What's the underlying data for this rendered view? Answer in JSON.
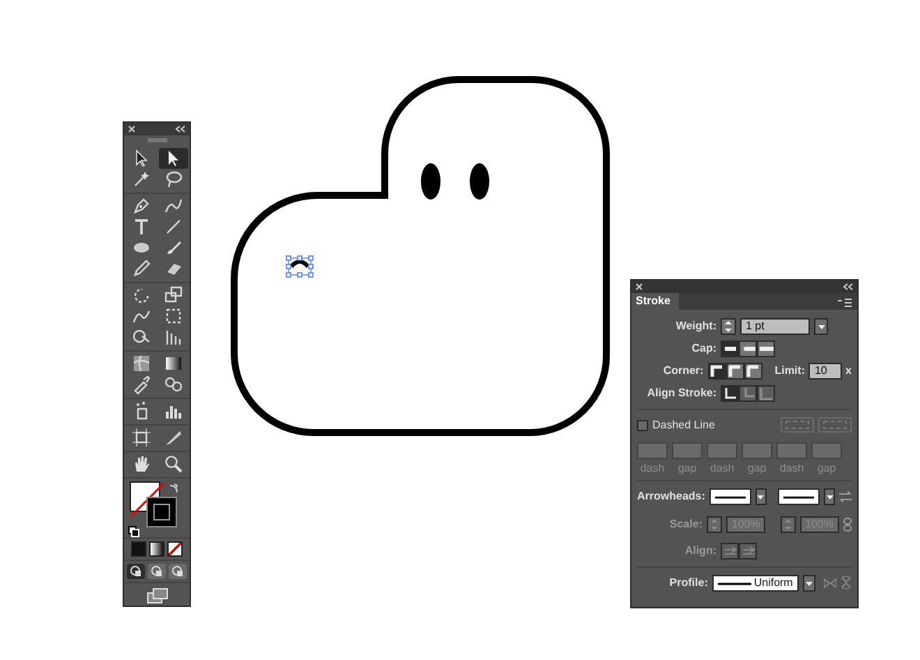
{
  "toolbar": {
    "tools": [
      {
        "kind": "selection",
        "selected": false
      },
      {
        "kind": "direct-selection",
        "selected": true
      },
      {
        "kind": "magic-wand",
        "selected": false
      },
      {
        "kind": "lasso",
        "selected": false
      },
      {
        "kind": "pen",
        "selected": false
      },
      {
        "kind": "curvature",
        "selected": false
      },
      {
        "kind": "type",
        "selected": false
      },
      {
        "kind": "line",
        "selected": false
      },
      {
        "kind": "ellipse",
        "selected": false
      },
      {
        "kind": "paintbrush",
        "selected": false
      },
      {
        "kind": "pencil",
        "selected": false
      },
      {
        "kind": "eraser",
        "selected": false
      },
      {
        "kind": "rotate",
        "selected": false
      },
      {
        "kind": "scale",
        "selected": false
      },
      {
        "kind": "warp",
        "selected": false
      },
      {
        "kind": "free-transform",
        "selected": false
      },
      {
        "kind": "shape-builder",
        "selected": false
      },
      {
        "kind": "perspective",
        "selected": false
      },
      {
        "kind": "mesh",
        "selected": false
      },
      {
        "kind": "gradient",
        "selected": false
      },
      {
        "kind": "eyedropper",
        "selected": false
      },
      {
        "kind": "blend",
        "selected": false
      },
      {
        "kind": "sprayer",
        "selected": false
      },
      {
        "kind": "graph",
        "selected": false
      },
      {
        "kind": "artboard",
        "selected": false
      },
      {
        "kind": "slice",
        "selected": false
      },
      {
        "kind": "hand",
        "selected": false
      },
      {
        "kind": "zoom",
        "selected": false
      }
    ],
    "color_modes": [
      {
        "kind": "color"
      },
      {
        "kind": "gradient"
      },
      {
        "kind": "none"
      }
    ],
    "draw_modes": [
      {
        "selected": true
      },
      {
        "selected": false
      },
      {
        "selected": false
      }
    ]
  },
  "stroke_panel": {
    "title": "Stroke",
    "weight": {
      "label": "Weight:",
      "value": "1 pt"
    },
    "cap": {
      "label": "Cap:",
      "options": [
        {
          "kind": "butt",
          "selected": true
        },
        {
          "kind": "round",
          "selected": false
        },
        {
          "kind": "projecting",
          "selected": false
        }
      ]
    },
    "corner": {
      "label": "Corner:",
      "options": [
        {
          "kind": "miter",
          "selected": true
        },
        {
          "kind": "round",
          "selected": false
        },
        {
          "kind": "bevel",
          "selected": false
        }
      ],
      "limit_label": "Limit:",
      "limit": "10",
      "limit_unit": "x"
    },
    "align_stroke": {
      "label": "Align Stroke:",
      "options": [
        {
          "kind": "center",
          "selected": true,
          "disabled": false
        },
        {
          "kind": "inside",
          "selected": false,
          "disabled": true
        },
        {
          "kind": "outside",
          "selected": false,
          "disabled": true
        }
      ]
    },
    "dashed_line": {
      "label": "Dashed Line",
      "checked": false
    },
    "dash_fields": [
      {
        "label": "dash"
      },
      {
        "label": "gap"
      },
      {
        "label": "dash"
      },
      {
        "label": "gap"
      },
      {
        "label": "dash"
      },
      {
        "label": "gap"
      }
    ],
    "arrowheads": {
      "label": "Arrowheads:"
    },
    "scale": {
      "label": "Scale:",
      "start": "100%",
      "end": "100%",
      "disabled": true
    },
    "align": {
      "label": "Align:",
      "disabled": true
    },
    "profile": {
      "label": "Profile:",
      "value": "Uniform"
    }
  }
}
